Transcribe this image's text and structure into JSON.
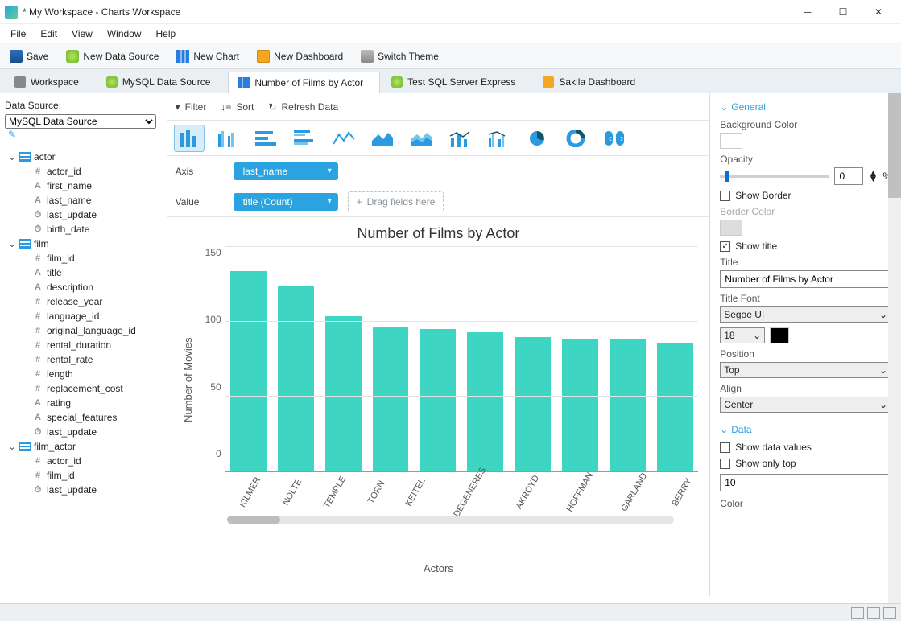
{
  "window": {
    "title": "* My Workspace - Charts Workspace"
  },
  "menu": [
    "File",
    "Edit",
    "View",
    "Window",
    "Help"
  ],
  "toolbar": [
    {
      "id": "save",
      "label": "Save"
    },
    {
      "id": "new-data-source",
      "label": "New Data Source"
    },
    {
      "id": "new-chart",
      "label": "New Chart"
    },
    {
      "id": "new-dashboard",
      "label": "New Dashboard"
    },
    {
      "id": "switch-theme",
      "label": "Switch Theme"
    }
  ],
  "tabs": [
    {
      "label": "Workspace",
      "icon": "ws"
    },
    {
      "label": "MySQL Data Source",
      "icon": "db"
    },
    {
      "label": "Number of Films by Actor",
      "icon": "chart",
      "active": true
    },
    {
      "label": "Test SQL Server Express",
      "icon": "sql"
    },
    {
      "label": "Sakila Dashboard",
      "icon": "dash"
    }
  ],
  "sidebar": {
    "label": "Data Source:",
    "selected": "MySQL Data Source",
    "tree": [
      {
        "name": "actor",
        "cols": [
          {
            "n": "actor_id",
            "t": "#"
          },
          {
            "n": "first_name",
            "t": "A"
          },
          {
            "n": "last_name",
            "t": "A"
          },
          {
            "n": "last_update",
            "t": "⏱"
          },
          {
            "n": "birth_date",
            "t": "⏱"
          }
        ]
      },
      {
        "name": "film",
        "cols": [
          {
            "n": "film_id",
            "t": "#"
          },
          {
            "n": "title",
            "t": "A"
          },
          {
            "n": "description",
            "t": "A"
          },
          {
            "n": "release_year",
            "t": "#"
          },
          {
            "n": "language_id",
            "t": "#"
          },
          {
            "n": "original_language_id",
            "t": "#"
          },
          {
            "n": "rental_duration",
            "t": "#"
          },
          {
            "n": "rental_rate",
            "t": "#"
          },
          {
            "n": "length",
            "t": "#"
          },
          {
            "n": "replacement_cost",
            "t": "#"
          },
          {
            "n": "rating",
            "t": "A"
          },
          {
            "n": "special_features",
            "t": "A"
          },
          {
            "n": "last_update",
            "t": "⏱"
          }
        ]
      },
      {
        "name": "film_actor",
        "cols": [
          {
            "n": "actor_id",
            "t": "#"
          },
          {
            "n": "film_id",
            "t": "#"
          },
          {
            "n": "last_update",
            "t": "⏱"
          }
        ]
      }
    ]
  },
  "chart_toolbar": {
    "filter": "Filter",
    "sort": "Sort",
    "refresh": "Refresh Data"
  },
  "fields": {
    "axis_label": "Axis",
    "axis_value": "last_name",
    "value_label": "Value",
    "value_value": "title (Count)",
    "dropzone": "Drag fields here"
  },
  "props": {
    "general": "General",
    "bgcolor": "Background Color",
    "opacity": "Opacity",
    "opacity_val": "0",
    "opacity_unit": "%",
    "show_border": "Show Border",
    "show_border_checked": false,
    "border_color": "Border Color",
    "show_title": "Show title",
    "show_title_checked": true,
    "title": "Title",
    "title_val": "Number of Films by Actor",
    "title_font": "Title Font",
    "title_font_val": "Segoe UI",
    "title_size": "18",
    "position": "Position",
    "position_val": "Top",
    "align": "Align",
    "align_val": "Center",
    "data": "Data",
    "show_data_values": "Show data values",
    "show_data_checked": false,
    "show_only_top": "Show only top",
    "show_only_top_checked": false,
    "top_n": "10",
    "color_lbl": "Color"
  },
  "chart_data": {
    "type": "bar",
    "title": "Number of Films by Actor",
    "xlabel": "Actors",
    "ylabel": "Number of Movies",
    "ylim": [
      0,
      150
    ],
    "yticks": [
      0,
      50,
      100,
      150
    ],
    "categories": [
      "KILMER",
      "NOLTE",
      "TEMPLE",
      "TORN",
      "KEITEL",
      "DEGENERES",
      "AKROYD",
      "HOFFMAN",
      "GARLAND",
      "BERRY"
    ],
    "values": [
      134,
      124,
      104,
      96,
      95,
      93,
      90,
      88,
      88,
      86
    ]
  }
}
